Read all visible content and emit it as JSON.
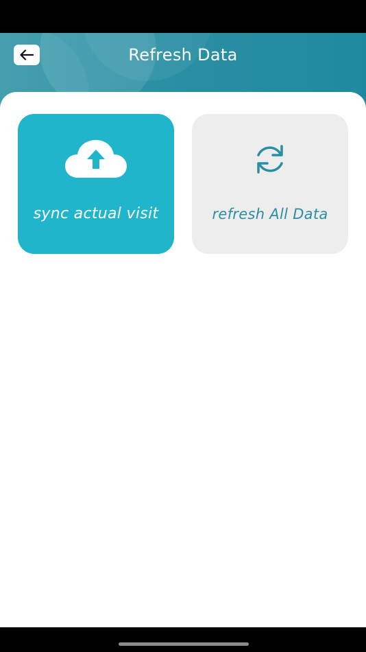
{
  "header": {
    "title": "Refresh Data",
    "back_icon": "arrow-left-icon",
    "background_color": "#2a8fa3"
  },
  "cards": [
    {
      "label": "sync actual visit",
      "icon": "cloud-upload-icon",
      "background_color": "#21b5cc",
      "text_color": "#ffffff"
    },
    {
      "label": "refresh All Data",
      "icon": "sync-icon",
      "background_color": "#ededed",
      "text_color": "#2a8ea4"
    }
  ]
}
